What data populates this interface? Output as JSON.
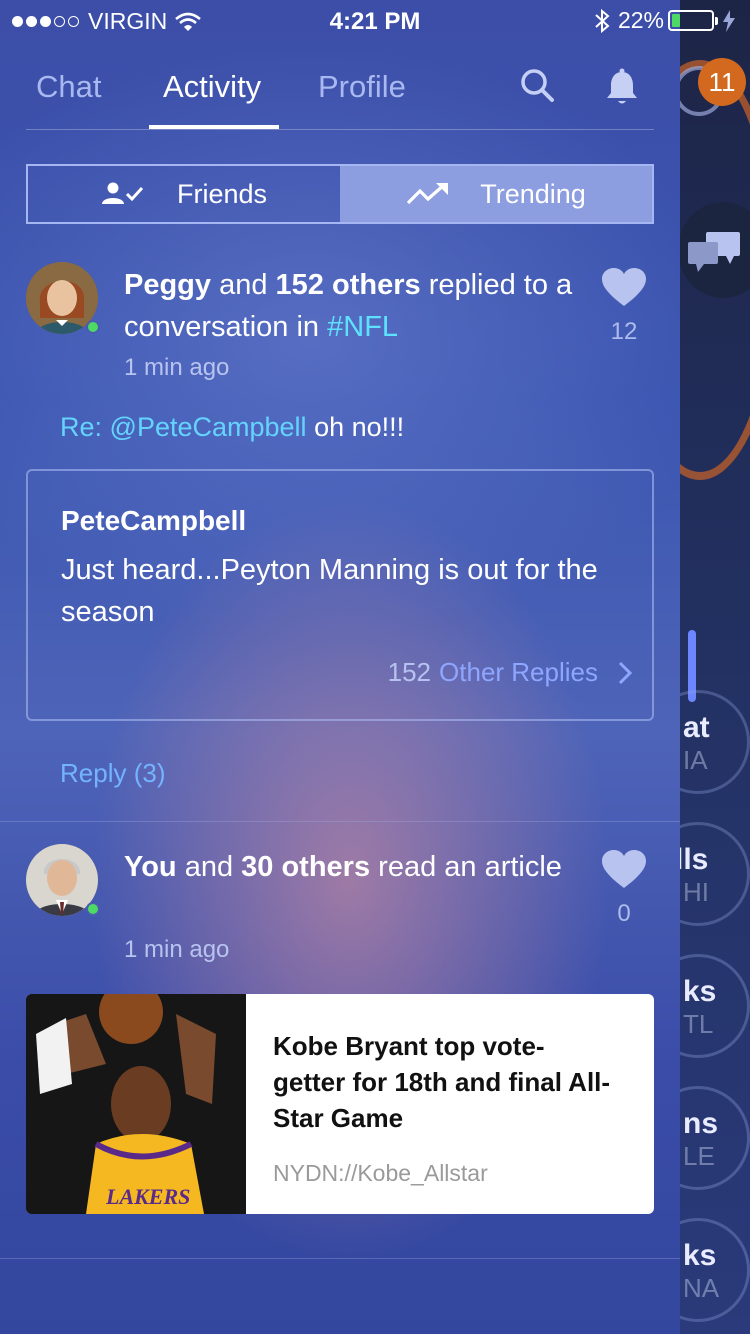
{
  "status_bar": {
    "carrier": "VIRGIN",
    "time": "4:21 PM",
    "battery_percent": "22%",
    "battery_level": 0.22,
    "signal_bars_filled": 3,
    "signal_bars_total": 5
  },
  "nav": {
    "tabs": [
      {
        "label": "Chat",
        "active": false
      },
      {
        "label": "Activity",
        "active": true
      },
      {
        "label": "Profile",
        "active": false
      }
    ],
    "icons": [
      "search-icon",
      "bell-icon"
    ]
  },
  "segment": {
    "friends_label": "Friends",
    "trending_label": "Trending",
    "active": "Trending"
  },
  "feed": [
    {
      "actor": "Peggy",
      "connector": "and",
      "others": "152 others",
      "action": "replied to a conversation in",
      "hashtag": "#NFL",
      "time": "1 min ago",
      "likes": "12",
      "re_prefix": "Re:",
      "re_mention": "@PeteCampbell",
      "re_text": "oh no!!!",
      "quote": {
        "author": "PeteCampbell",
        "text": "Just heard...Peyton Manning is out for the season",
        "replies_count": "152",
        "replies_label": "Other Replies"
      },
      "reply_label": "Reply (3)"
    },
    {
      "actor": "You",
      "connector": "and",
      "others": "30 others",
      "action": "read an article",
      "time": "1 min ago",
      "likes": "0",
      "article": {
        "title": "Kobe Bryant top vote-getter for 18th and final All-Star Game",
        "source": "NYDN://Kobe_Allstar",
        "image_jersey_text": "LAKERS"
      }
    }
  ],
  "background": {
    "badge_count": "11",
    "teams": [
      {
        "abbr": "at",
        "city": "IA"
      },
      {
        "abbr": "lls",
        "city": "HI"
      },
      {
        "abbr": "ks",
        "city": "TL"
      },
      {
        "abbr": "ns",
        "city": "LE"
      },
      {
        "abbr": "ks",
        "city": "NA"
      }
    ]
  },
  "colors": {
    "accent_online": "#4cd964",
    "hashtag": "#5ee1ff",
    "link": "#74b3ff",
    "badge": "#d2691e"
  }
}
